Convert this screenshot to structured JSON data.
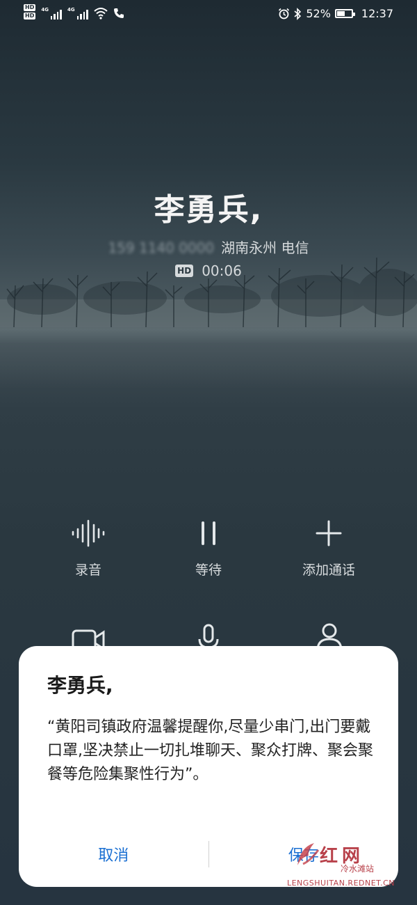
{
  "status_bar": {
    "hd_1": "HD",
    "hd_2": "HD",
    "net_1": "4G",
    "net_2": "4G",
    "battery_percent": "52%",
    "battery_level": 0.52,
    "time": "12:37"
  },
  "call": {
    "caller_name": "李勇兵,",
    "number_masked": "159 1140 0000",
    "location_carrier": "湖南永州 电信",
    "hd_badge": "HD",
    "duration": "00:06"
  },
  "controls": {
    "record_label": "录音",
    "hold_label": "等待",
    "add_call_label": "添加通话"
  },
  "dialog": {
    "title": "李勇兵,",
    "message": "“黄阳司镇政府温馨提醒你,尽量少串门,出门要戴口罩,坚决禁止一切扎堆聊天、聚众打牌、聚会聚餐等危险集聚性行为”。",
    "cancel_label": "取消",
    "save_label": "保存"
  },
  "watermark": {
    "brand": "红网",
    "sub": "冷水滩站",
    "url": "LENGSHUITAN.REDNET.CN"
  }
}
